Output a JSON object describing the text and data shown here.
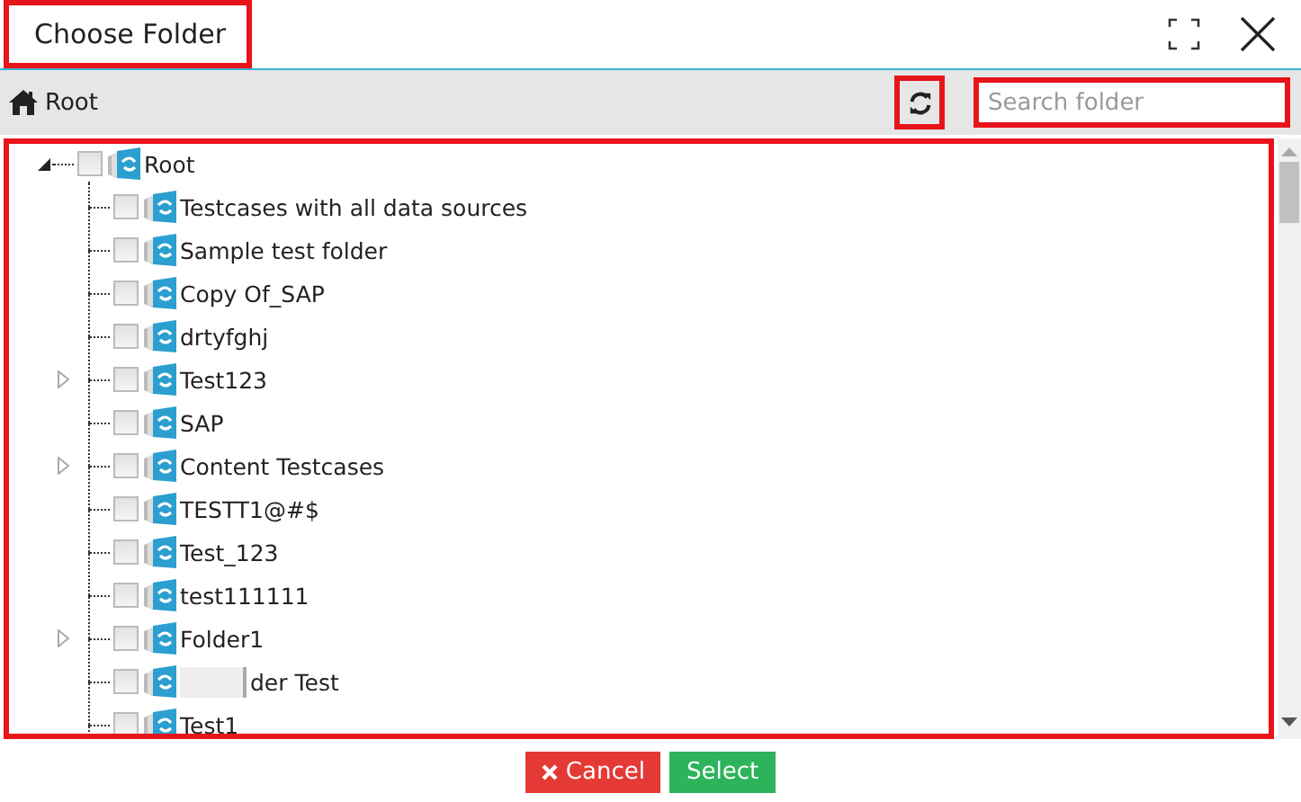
{
  "window": {
    "title": "Choose Folder",
    "title_highlighted": true
  },
  "toolbar": {
    "breadcrumb": "Root",
    "refresh_highlighted": true,
    "search": {
      "placeholder": "Search folder",
      "highlighted": true
    }
  },
  "tree": {
    "highlighted": true,
    "root": {
      "label": "Root",
      "expanded": true,
      "checked": false,
      "children": [
        {
          "label": "Testcases with all data sources",
          "checked": false,
          "expandable": false
        },
        {
          "label": "Sample test folder",
          "checked": false,
          "expandable": false
        },
        {
          "label": "Copy Of_SAP",
          "checked": false,
          "expandable": false
        },
        {
          "label": "drtyfghj",
          "checked": false,
          "expandable": false
        },
        {
          "label": "Test123",
          "checked": false,
          "expandable": true
        },
        {
          "label": "SAP",
          "checked": false,
          "expandable": false
        },
        {
          "label": "Content Testcases",
          "checked": false,
          "expandable": true
        },
        {
          "label": "TESTT1@#$",
          "checked": false,
          "expandable": false
        },
        {
          "label": "Test_123",
          "checked": false,
          "expandable": false
        },
        {
          "label": "test111111",
          "checked": false,
          "expandable": false
        },
        {
          "label": "Folder1",
          "checked": false,
          "expandable": true
        },
        {
          "label": "der Test",
          "checked": false,
          "expandable": false,
          "redacted": true
        },
        {
          "label": "Test1",
          "checked": false,
          "expandable": false
        }
      ]
    }
  },
  "buttons": [
    {
      "kind": "cancel",
      "label": "Cancel"
    },
    {
      "kind": "select",
      "label": "Select"
    }
  ]
}
